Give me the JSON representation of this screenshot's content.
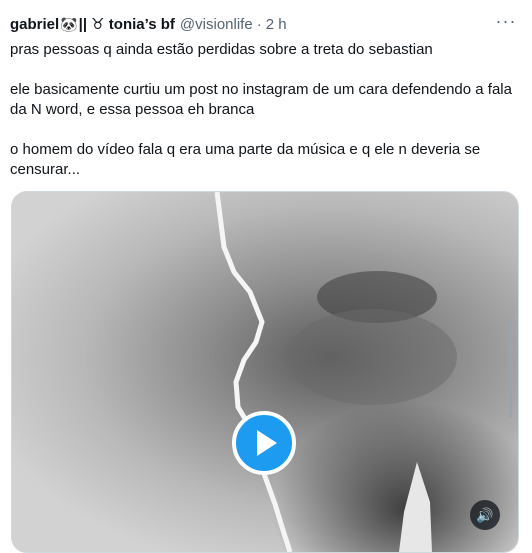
{
  "tweet": {
    "name": "gabriel",
    "name_emoji": "🐼",
    "name_suffix": "|| ♉ tonia’s bf",
    "handle": "@visionlife",
    "dot": "·",
    "time": "2 h",
    "more_icon": "more-icon",
    "paragraphs": [
      "pras pessoas q ainda estão perdidas sobre a treta do sebastian",
      "ele basicamente curtiu um post no instagram de um cara defendendo a fala da N word, e essa pessoa eh branca",
      "o homem do vídeo fala q era uma parte da música e q ele n deveria se censurar..."
    ]
  },
  "media": {
    "type": "video",
    "play_icon": "play-icon",
    "volume_icon": "volume-icon",
    "accent": "#1d9bf0"
  }
}
